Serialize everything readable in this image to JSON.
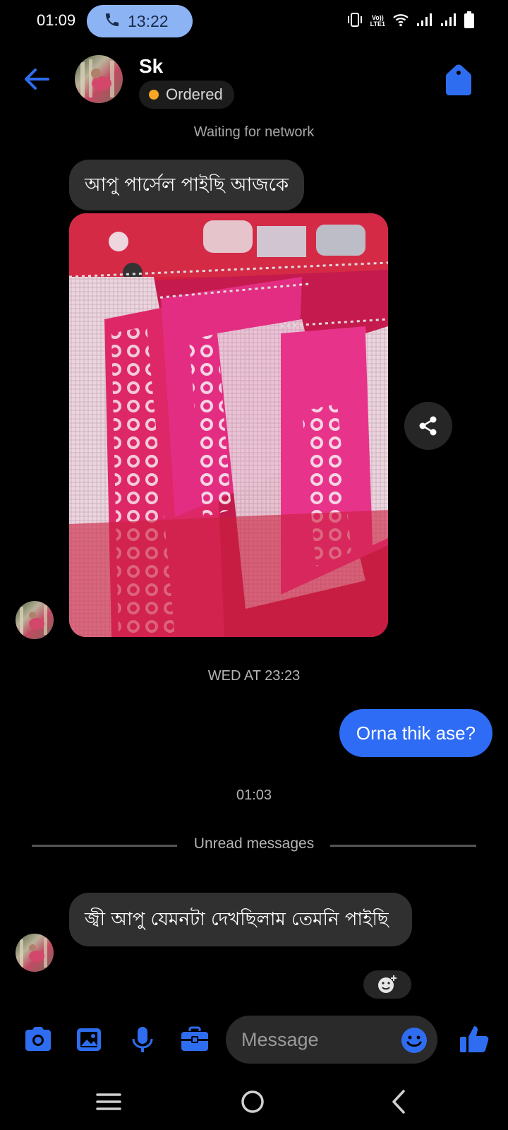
{
  "status_bar": {
    "clock": "01:09",
    "call_time": "13:22",
    "volte_top": "Vo))",
    "volte_bottom": "LTE1"
  },
  "header": {
    "contact_name": "Sk",
    "order_status": "Ordered",
    "order_status_color": "#f5a623"
  },
  "network_status": "Waiting for network",
  "messages": {
    "incoming_1": "আপু পার্সেল পাইছি আজকে",
    "photo_subject": "pink bandhani dupattas on red bedsheet",
    "timestamp_1": "WED AT 23:23",
    "outgoing_1": "Orna thik ase?",
    "timestamp_2": "01:03",
    "unread_divider": "Unread messages",
    "incoming_2": "জ্বী আপু যেমনটা দেখছিলাম তেমনি পাইছি"
  },
  "composer": {
    "placeholder": "Message",
    "icons": [
      "camera-icon",
      "gallery-icon",
      "microphone-icon",
      "briefcase-icon",
      "emoji-icon",
      "thumbs-up-icon"
    ]
  },
  "colors": {
    "accent": "#2e6cf5",
    "icon_blue": "#2f6df0",
    "incoming_bubble": "#303030",
    "background": "#000000"
  }
}
